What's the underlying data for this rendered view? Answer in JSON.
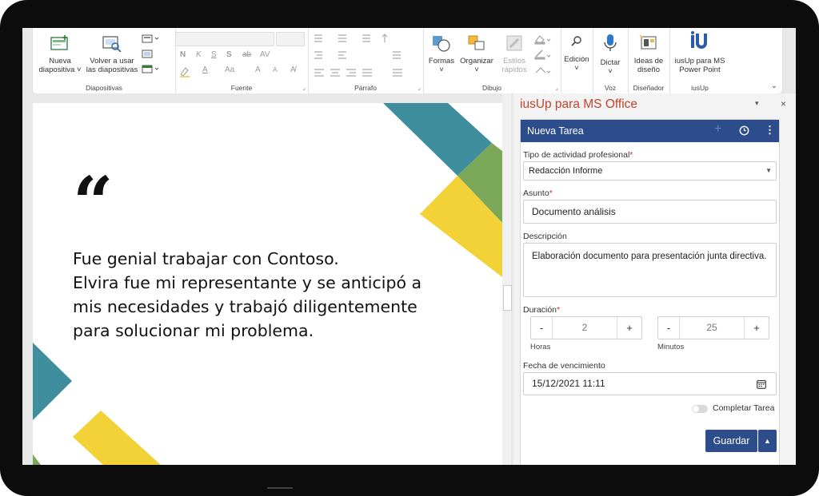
{
  "ribbon": {
    "diapositivas": {
      "nueva_line1": "Nueva",
      "nueva_line2": "diapositiva ˅",
      "reuse_line1": "Volver a usar",
      "reuse_line2": "las diapositivas",
      "label": "Diapositivas"
    },
    "fuente": {
      "bold": "N",
      "italic": "K",
      "underline": "S",
      "shadow": "S",
      "strike": "ab",
      "spacing": "AV",
      "case": "Aa",
      "grow": "A",
      "shrink": "A",
      "label": "Fuente"
    },
    "parrafo": {
      "label": "Párrafo"
    },
    "dibujo": {
      "formas": "Formas",
      "organizar": "Organizar",
      "estilos_line1": "Estilos",
      "estilos_line2": "rápidos",
      "label": "Dibujo"
    },
    "edicion": {
      "label": "Edición"
    },
    "voz": {
      "dictar": "Dictar",
      "label": "Voz"
    },
    "disenador": {
      "line1": "Ideas de",
      "line2": "diseño",
      "label": "Diseñador"
    },
    "iusup": {
      "line1": "iusUp para MS",
      "line2": "Power Point",
      "label": "iusUp"
    }
  },
  "slide": {
    "quote_mark": "“",
    "lines": [
      "Fue genial trabajar con Contoso.",
      "Elvira fue mi representante y se anticipó a",
      "mis necesidades y trabajó diligentemente",
      "para solucionar mi problema."
    ]
  },
  "pane": {
    "title": "iusUp para MS Office",
    "card_title": "Nueva Tarea",
    "activity_label": "Tipo de actividad profesional",
    "activity_value": "Redacción Informe",
    "subject_label": "Asunto",
    "subject_value": "Documento análisis",
    "description_label": "Descripción",
    "description_value": "Elaboración documento para presentación junta directiva.",
    "duration_label": "Duración",
    "hours_value": "2",
    "hours_label": "Horas",
    "minutes_value": "25",
    "minutes_label": "Minutos",
    "due_label": "Fecha de vencimiento",
    "due_value": "15/12/2021 11:11",
    "complete_label": "Completar Tarea",
    "save_label": "Guardar",
    "required_mark": "*",
    "minus": "-",
    "plus": "+"
  },
  "colors": {
    "accent_blue": "#2c4c8c",
    "pane_title": "#c0442e",
    "teal": "#3f8e9e",
    "green": "#7ba858",
    "yellow": "#f2d237"
  },
  "icons": [
    "new-slide-icon",
    "reuse-slides-icon",
    "layout-icon",
    "reset-icon",
    "section-icon",
    "shapes-icon",
    "arrange-icon",
    "quick-styles-icon",
    "search-icon",
    "microphone-icon",
    "design-ideas-icon",
    "iusup-logo-icon",
    "plus-icon",
    "clock-icon",
    "more-icon",
    "calendar-icon",
    "chevron-down-icon",
    "caret-up-icon"
  ]
}
